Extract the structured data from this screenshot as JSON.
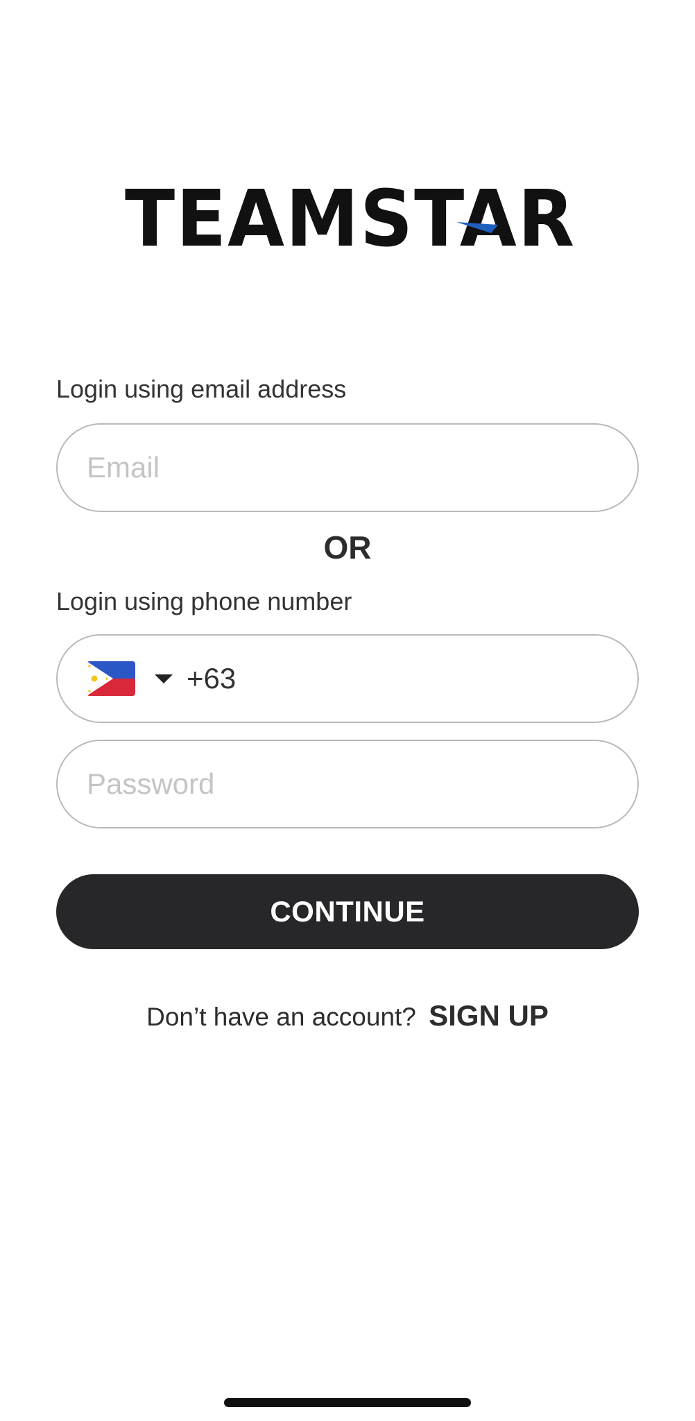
{
  "logo": {
    "text": "TEAMSTAR",
    "accent_color": "#1f5fbf"
  },
  "email_section": {
    "label": "Login using email address",
    "placeholder": "Email",
    "value": ""
  },
  "divider": {
    "text": "OR"
  },
  "phone_section": {
    "label": "Login using phone number",
    "country_flag": "philippines-flag",
    "dial_code": "+63"
  },
  "password": {
    "placeholder": "Password",
    "value": ""
  },
  "continue_button": {
    "label": "CONTINUE",
    "color": "#27272a"
  },
  "signup": {
    "prompt": "Don’t have an account?",
    "link_label": "SIGN UP"
  }
}
